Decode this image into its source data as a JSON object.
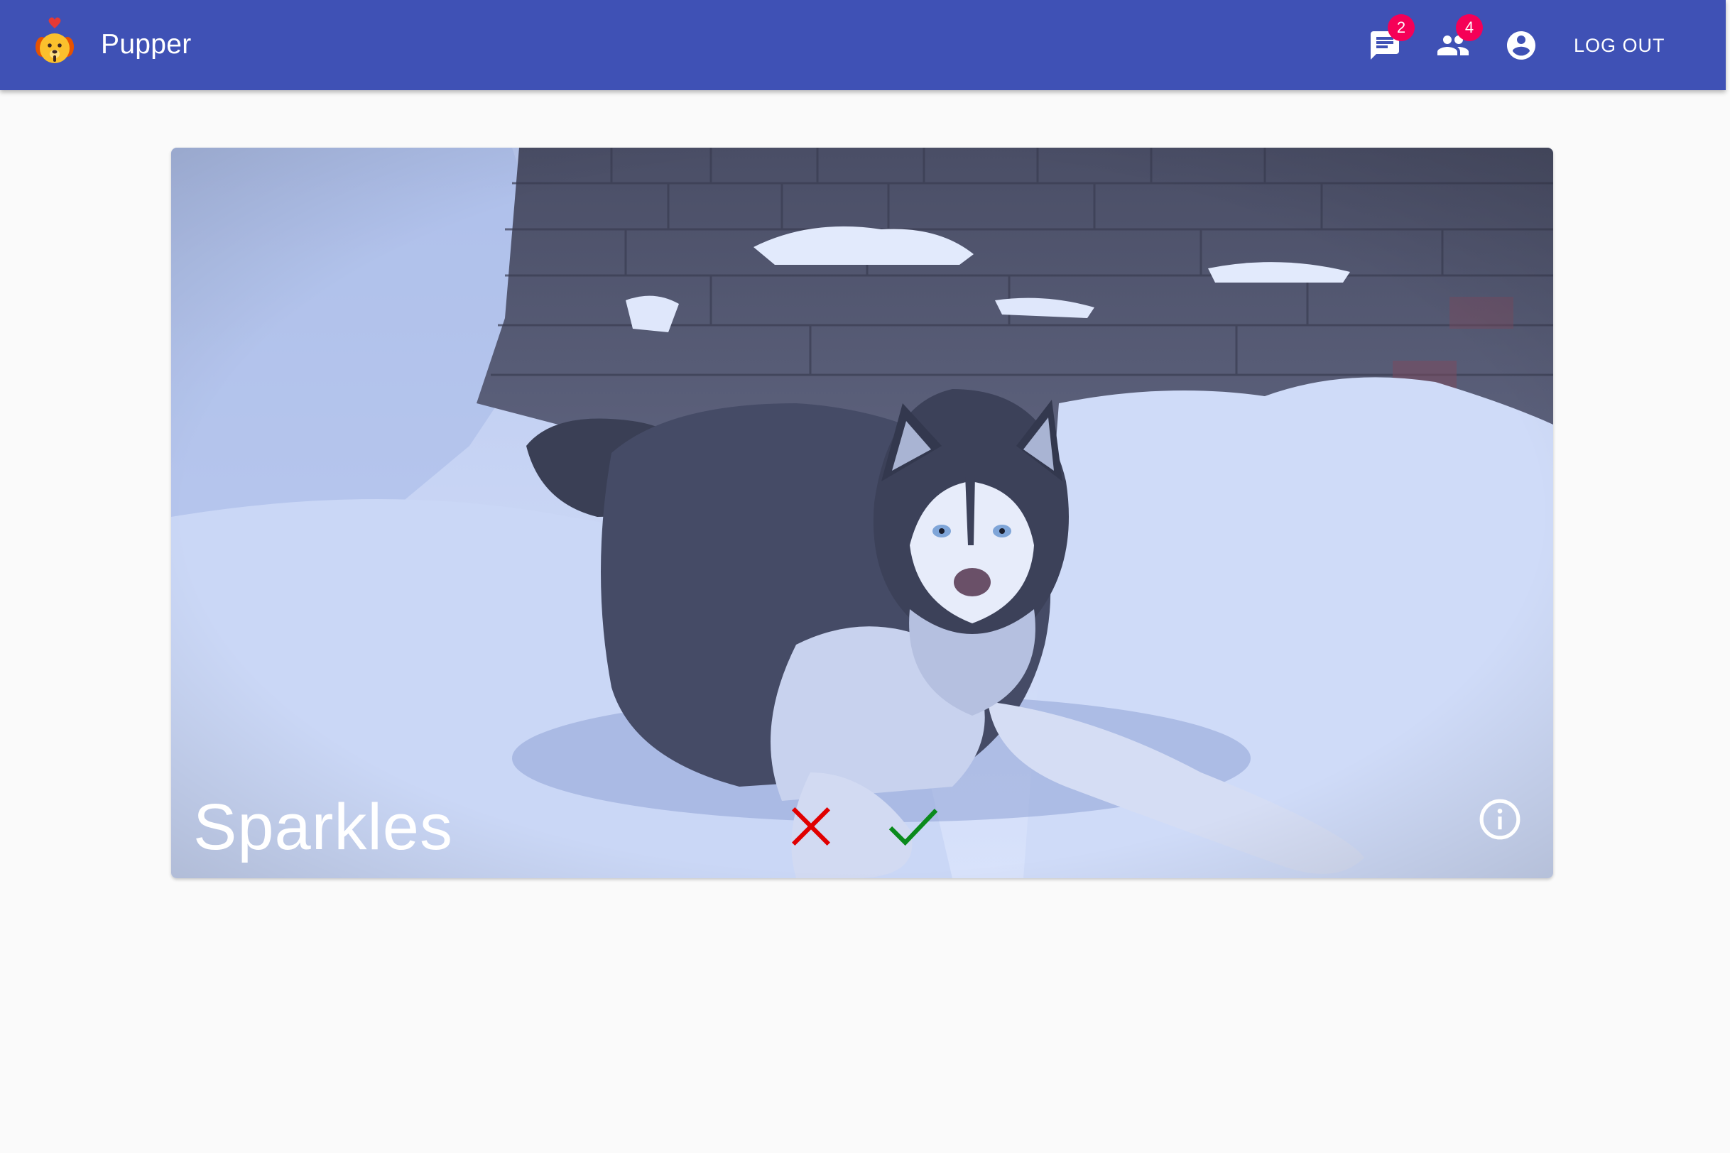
{
  "app": {
    "title": "Pupper",
    "logo_icon": "dog-heart-logo"
  },
  "toolbar": {
    "messages_badge": "2",
    "matches_badge": "4",
    "logout_label": "LOG OUT",
    "icons": [
      "chat-icon",
      "people-icon",
      "account-circle-icon"
    ]
  },
  "card": {
    "dog_name": "Sparkles",
    "reject_icon": "close-icon",
    "accept_icon": "check-icon",
    "info_icon": "info-icon"
  },
  "colors": {
    "appbar": "#3f51b5",
    "badge": "#f50057",
    "reject": "#e00000",
    "accept": "#0a8a1c",
    "background": "#fafafa"
  }
}
